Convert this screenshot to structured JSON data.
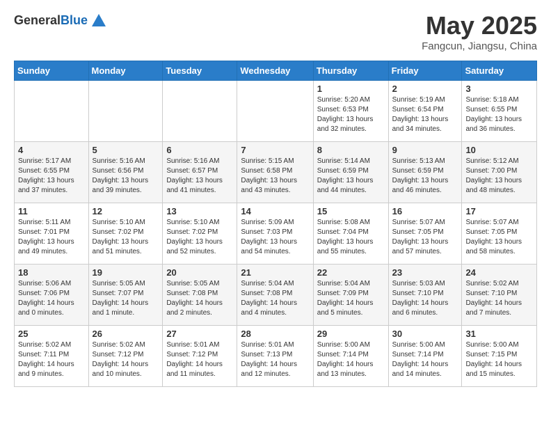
{
  "logo": {
    "general": "General",
    "blue": "Blue"
  },
  "title": "May 2025",
  "subtitle": "Fangcun, Jiangsu, China",
  "days_of_week": [
    "Sunday",
    "Monday",
    "Tuesday",
    "Wednesday",
    "Thursday",
    "Friday",
    "Saturday"
  ],
  "weeks": [
    [
      {
        "day": "",
        "info": ""
      },
      {
        "day": "",
        "info": ""
      },
      {
        "day": "",
        "info": ""
      },
      {
        "day": "",
        "info": ""
      },
      {
        "day": "1",
        "info": "Sunrise: 5:20 AM\nSunset: 6:53 PM\nDaylight: 13 hours\nand 32 minutes."
      },
      {
        "day": "2",
        "info": "Sunrise: 5:19 AM\nSunset: 6:54 PM\nDaylight: 13 hours\nand 34 minutes."
      },
      {
        "day": "3",
        "info": "Sunrise: 5:18 AM\nSunset: 6:55 PM\nDaylight: 13 hours\nand 36 minutes."
      }
    ],
    [
      {
        "day": "4",
        "info": "Sunrise: 5:17 AM\nSunset: 6:55 PM\nDaylight: 13 hours\nand 37 minutes."
      },
      {
        "day": "5",
        "info": "Sunrise: 5:16 AM\nSunset: 6:56 PM\nDaylight: 13 hours\nand 39 minutes."
      },
      {
        "day": "6",
        "info": "Sunrise: 5:16 AM\nSunset: 6:57 PM\nDaylight: 13 hours\nand 41 minutes."
      },
      {
        "day": "7",
        "info": "Sunrise: 5:15 AM\nSunset: 6:58 PM\nDaylight: 13 hours\nand 43 minutes."
      },
      {
        "day": "8",
        "info": "Sunrise: 5:14 AM\nSunset: 6:59 PM\nDaylight: 13 hours\nand 44 minutes."
      },
      {
        "day": "9",
        "info": "Sunrise: 5:13 AM\nSunset: 6:59 PM\nDaylight: 13 hours\nand 46 minutes."
      },
      {
        "day": "10",
        "info": "Sunrise: 5:12 AM\nSunset: 7:00 PM\nDaylight: 13 hours\nand 48 minutes."
      }
    ],
    [
      {
        "day": "11",
        "info": "Sunrise: 5:11 AM\nSunset: 7:01 PM\nDaylight: 13 hours\nand 49 minutes."
      },
      {
        "day": "12",
        "info": "Sunrise: 5:10 AM\nSunset: 7:02 PM\nDaylight: 13 hours\nand 51 minutes."
      },
      {
        "day": "13",
        "info": "Sunrise: 5:10 AM\nSunset: 7:02 PM\nDaylight: 13 hours\nand 52 minutes."
      },
      {
        "day": "14",
        "info": "Sunrise: 5:09 AM\nSunset: 7:03 PM\nDaylight: 13 hours\nand 54 minutes."
      },
      {
        "day": "15",
        "info": "Sunrise: 5:08 AM\nSunset: 7:04 PM\nDaylight: 13 hours\nand 55 minutes."
      },
      {
        "day": "16",
        "info": "Sunrise: 5:07 AM\nSunset: 7:05 PM\nDaylight: 13 hours\nand 57 minutes."
      },
      {
        "day": "17",
        "info": "Sunrise: 5:07 AM\nSunset: 7:05 PM\nDaylight: 13 hours\nand 58 minutes."
      }
    ],
    [
      {
        "day": "18",
        "info": "Sunrise: 5:06 AM\nSunset: 7:06 PM\nDaylight: 14 hours\nand 0 minutes."
      },
      {
        "day": "19",
        "info": "Sunrise: 5:05 AM\nSunset: 7:07 PM\nDaylight: 14 hours\nand 1 minute."
      },
      {
        "day": "20",
        "info": "Sunrise: 5:05 AM\nSunset: 7:08 PM\nDaylight: 14 hours\nand 2 minutes."
      },
      {
        "day": "21",
        "info": "Sunrise: 5:04 AM\nSunset: 7:08 PM\nDaylight: 14 hours\nand 4 minutes."
      },
      {
        "day": "22",
        "info": "Sunrise: 5:04 AM\nSunset: 7:09 PM\nDaylight: 14 hours\nand 5 minutes."
      },
      {
        "day": "23",
        "info": "Sunrise: 5:03 AM\nSunset: 7:10 PM\nDaylight: 14 hours\nand 6 minutes."
      },
      {
        "day": "24",
        "info": "Sunrise: 5:02 AM\nSunset: 7:10 PM\nDaylight: 14 hours\nand 7 minutes."
      }
    ],
    [
      {
        "day": "25",
        "info": "Sunrise: 5:02 AM\nSunset: 7:11 PM\nDaylight: 14 hours\nand 9 minutes."
      },
      {
        "day": "26",
        "info": "Sunrise: 5:02 AM\nSunset: 7:12 PM\nDaylight: 14 hours\nand 10 minutes."
      },
      {
        "day": "27",
        "info": "Sunrise: 5:01 AM\nSunset: 7:12 PM\nDaylight: 14 hours\nand 11 minutes."
      },
      {
        "day": "28",
        "info": "Sunrise: 5:01 AM\nSunset: 7:13 PM\nDaylight: 14 hours\nand 12 minutes."
      },
      {
        "day": "29",
        "info": "Sunrise: 5:00 AM\nSunset: 7:14 PM\nDaylight: 14 hours\nand 13 minutes."
      },
      {
        "day": "30",
        "info": "Sunrise: 5:00 AM\nSunset: 7:14 PM\nDaylight: 14 hours\nand 14 minutes."
      },
      {
        "day": "31",
        "info": "Sunrise: 5:00 AM\nSunset: 7:15 PM\nDaylight: 14 hours\nand 15 minutes."
      }
    ]
  ]
}
